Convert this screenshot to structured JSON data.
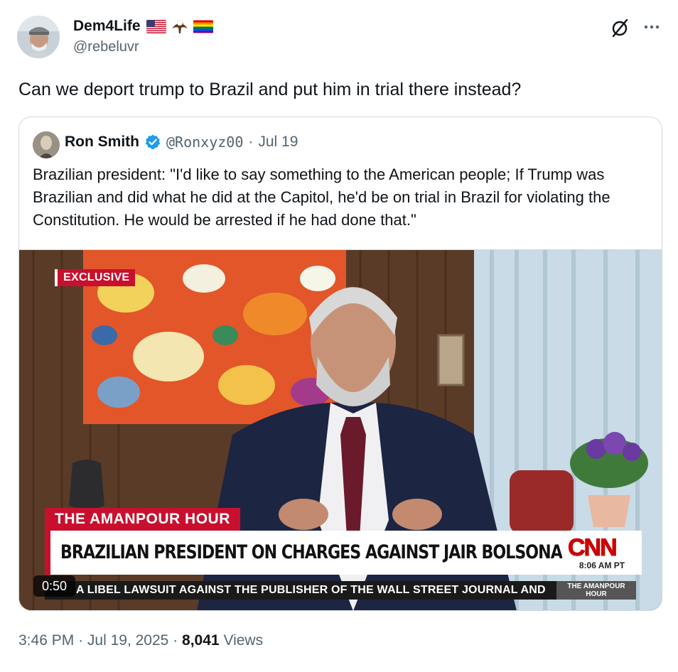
{
  "author": {
    "name": "Dem4Life",
    "handle": "@rebeluvr",
    "badges": [
      "us-flag-icon",
      "eagle-icon",
      "rainbow-flag-icon"
    ]
  },
  "tweet": {
    "text": "Can we deport trump to Brazil and put him in trial there instead?"
  },
  "quote": {
    "name": "Ron Smith",
    "verified": true,
    "handle": "@Ronxyz00",
    "separator": "·",
    "date": "Jul 19",
    "text": "Brazilian president: \"I'd like to say something to the American people; If Trump was Brazilian and did what he did at the Capitol, he'd be on trial in Brazil for violating the Constitution. He would be arrested if he had done that.\""
  },
  "video": {
    "exclusive_label": "EXCLUSIVE",
    "show_label": "THE AMANPOUR HOUR",
    "headline": "BRAZILIAN PRESIDENT ON CHARGES AGAINST JAIR BOLSONARO",
    "network": "CNN",
    "time": "8:06 AM PT",
    "ticker": "A LIBEL LAWSUIT AGAINST THE PUBLISHER OF THE WALL STREET JOURNAL AND",
    "ticker_show_line1": "THE AMANPOUR",
    "ticker_show_line2": "HOUR",
    "duration": "0:50"
  },
  "meta": {
    "time": "3:46 PM",
    "dot": "·",
    "date": "Jul 19, 2025",
    "views_count": "8,041",
    "views_label": "Views"
  },
  "colors": {
    "text_primary": "#0f1419",
    "text_secondary": "#536471",
    "border": "#cfd9de",
    "verified_blue": "#1d9bf0",
    "cnn_red": "#cc0000"
  }
}
